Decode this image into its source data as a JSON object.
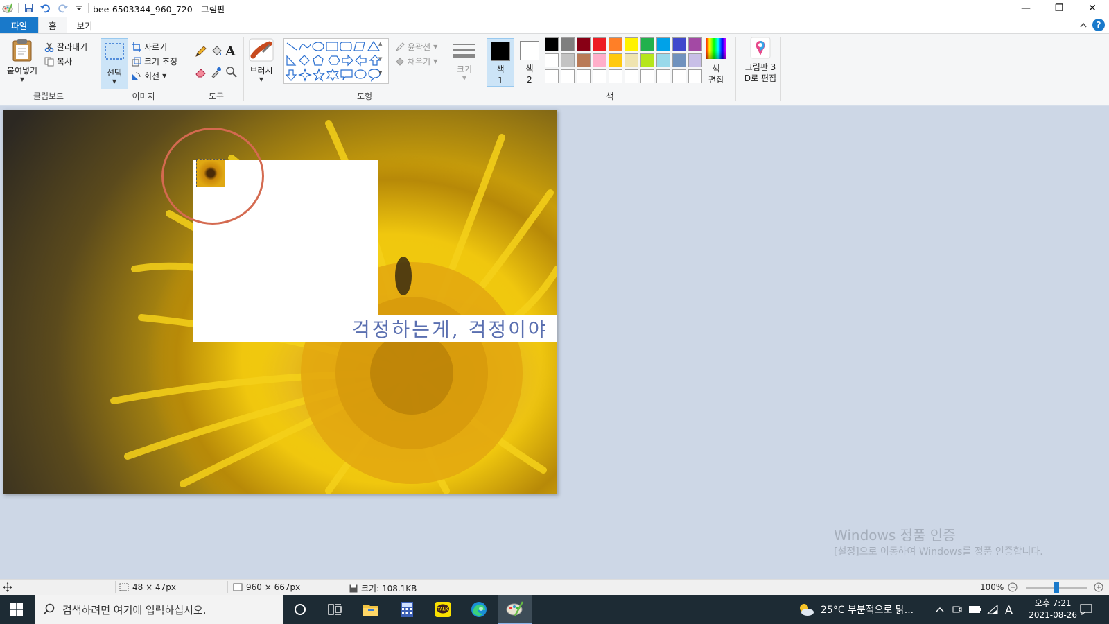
{
  "window": {
    "title": "bee-6503344_960_720 - 그림판",
    "minimize": "—",
    "restore": "❐",
    "close": "✕"
  },
  "tabs": {
    "file": "파일",
    "home": "홈",
    "view": "보기"
  },
  "ribbon": {
    "clipboard": {
      "paste": "붙여넣기",
      "cut": "잘라내기",
      "copy": "복사",
      "label": "클립보드"
    },
    "image": {
      "select": "선택",
      "crop": "자르기",
      "resize": "크기 조정",
      "rotate": "회전",
      "label": "이미지"
    },
    "tools": {
      "label": "도구"
    },
    "brushes": {
      "label": "브러시"
    },
    "shapes": {
      "outline": "윤곽선",
      "fill": "채우기",
      "label": "도형"
    },
    "size": {
      "label": "크기"
    },
    "colors": {
      "color1_top": "색",
      "color1_bottom": "1",
      "color2_top": "색",
      "color2_bottom": "2",
      "edit_top": "색",
      "edit_bottom": "편집",
      "paint3d_top": "그림판 3",
      "paint3d_bottom": "D로 편집",
      "label": "색",
      "color1": "#000000",
      "color2": "#ffffff",
      "palette_row1": [
        "#000000",
        "#7f7f7f",
        "#880015",
        "#ed1c24",
        "#ff7f27",
        "#fff200",
        "#22b14c",
        "#00a2e8",
        "#3f48cc",
        "#a349a4"
      ],
      "palette_row2": [
        "#ffffff",
        "#c3c3c3",
        "#b97a57",
        "#ffaec9",
        "#ffc90e",
        "#efe4b0",
        "#b5e61d",
        "#99d9ea",
        "#7092be",
        "#c8bfe7"
      ],
      "palette_row3_count": "10 empty custom slots"
    }
  },
  "canvas": {
    "text": "걱정하는게, 걱정이야 =)"
  },
  "watermark": {
    "line1": "Windows 정품 인증",
    "line2": "[설정]으로 이동하여 Windows를 정품 인증합니다."
  },
  "status": {
    "selection_size": "48 × 47px",
    "image_size": "960 × 667px",
    "file_size": "크기: 108.1KB",
    "zoom": "100%",
    "zoom_level": 1.0
  },
  "taskbar": {
    "search_placeholder": "검색하려면 여기에 입력하십시오.",
    "weather": "25°C  부분적으로 맑...",
    "ime": "A",
    "time": "오후 7:21",
    "date": "2021-08-26"
  }
}
